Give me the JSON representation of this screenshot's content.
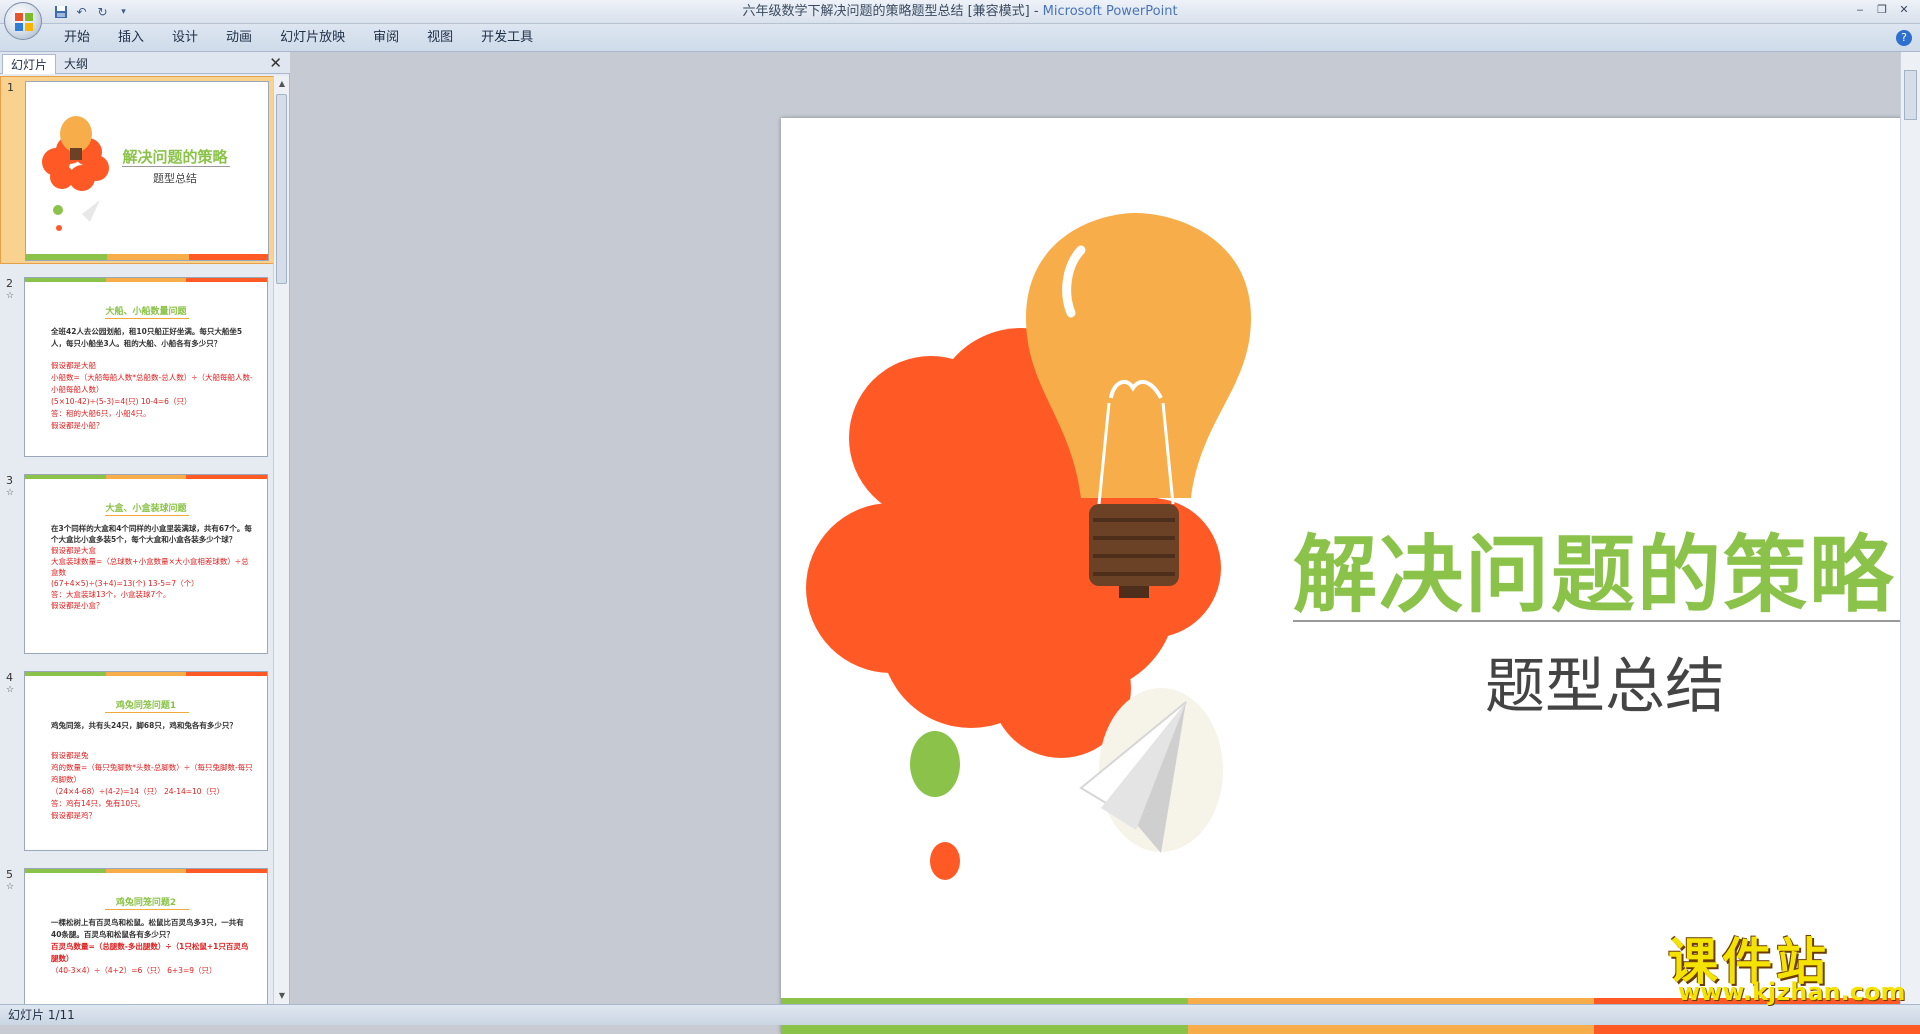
{
  "window": {
    "title": "六年级数学下解决问题的策略题型总结 [兼容模式] - ",
    "app_name": "Microsoft PowerPoint"
  },
  "ribbon": {
    "tabs": [
      "开始",
      "插入",
      "设计",
      "动画",
      "幻灯片放映",
      "审阅",
      "视图",
      "开发工具"
    ]
  },
  "left_pane": {
    "tab_slides": "幻灯片",
    "tab_outline": "大纲"
  },
  "thumbnails": [
    {
      "num": "1",
      "title": "解决问题的策略",
      "subtitle": "题型总结"
    },
    {
      "num": "2",
      "title": "大船、小船数量问题",
      "body": "全班42人去公园划船，租10只船正好坐满。每只大船坐5人，每只小船坐3人。租的大船、小船各有多少只？",
      "red": [
        "假设都是大船",
        "小船数=（大船每船人数*总船数-总人数）÷（大船每船人数-小船每船人数）",
        "(5×10-42)÷(5-3)=4(只)  10-4=6（只）",
        "答：租的大船6只，小船4只。",
        "假设都是小船？"
      ]
    },
    {
      "num": "3",
      "title": "大盒、小盒装球问题",
      "body": "在3个同样的大盒和4个同样的小盒里装满球，共有67个。每个大盒比小盒多装5个，每个大盒和小盒各装多少个球？",
      "red": [
        "假设都是大盒",
        "大盒装球数量=（总球数+小盒数量×大小盒相差球数）÷总盒数",
        "(67+4×5)÷(3+4)=13(个)  13-5=7（个）",
        "答：大盒装球13个，小盒装球7个。",
        "假设都是小盒？"
      ]
    },
    {
      "num": "4",
      "title": "鸡兔同笼问题1",
      "body": "鸡兔同笼，共有头24只，脚68只，鸡和兔各有多少只？",
      "red": [
        "假设都是兔",
        "鸡的数量=（每只兔脚数*头数-总脚数）÷（每只兔脚数-每只鸡脚数）",
        "（24×4-68）÷(4-2)=14（只） 24-14=10（只）",
        "答：鸡有14只，兔有10只。",
        "假设都是鸡？"
      ]
    },
    {
      "num": "5",
      "title": "鸡兔同笼问题2",
      "body": "一棵松树上有百灵鸟和松鼠。松鼠比百灵鸟多3只，一共有40条腿。百灵鸟和松鼠各有多少只？",
      "red": [
        "百灵鸟数量=（总腿数-多出腿数）÷（1只松鼠+1只百灵鸟腿数）",
        "（40-3×4）÷（4+2）=6（只） 6+3=9（只）"
      ]
    }
  ],
  "slide": {
    "title": "解决问题的策略",
    "subtitle": "题型总结"
  },
  "statusbar": {
    "text": "幻灯片 1/11"
  },
  "watermark": {
    "main": "课件站",
    "url": "www.kjzhan.com"
  },
  "colors": {
    "green": "#8bc34a",
    "orange": "#f7ae4a",
    "red_orange": "#ff5a26"
  }
}
